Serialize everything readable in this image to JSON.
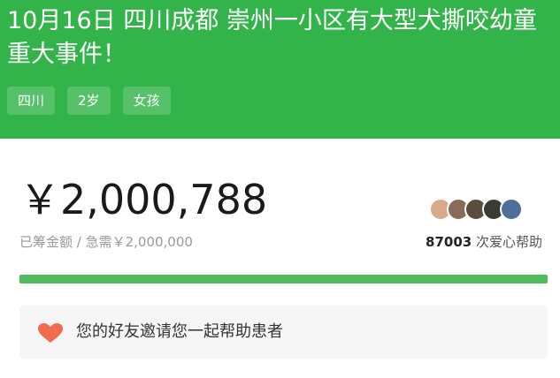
{
  "header": {
    "title": "10月16日 四川成都 崇州一小区有大型犬撕咬幼童重大事件！",
    "tags": [
      "四川",
      "2岁",
      "女孩"
    ],
    "bg_color": "#33b44a"
  },
  "funding": {
    "amount": "￥2,000,788",
    "raised_label": "已筹金额 / 急需￥2,000,000",
    "help_count": "87003",
    "help_suffix": " 次爱心帮助",
    "progress": 1.0,
    "progress_color": "#4fbb5d"
  },
  "avatars": [
    {
      "icon": "avatar-1",
      "color": "#d9a98c"
    },
    {
      "icon": "avatar-2",
      "color": "#8a6b5a"
    },
    {
      "icon": "avatar-3",
      "color": "#5a4d3e"
    },
    {
      "icon": "avatar-4",
      "color": "#3b3b35"
    },
    {
      "icon": "avatar-5",
      "color": "#4f6f9a"
    }
  ],
  "invite": {
    "text": "您的好友邀请您一起帮助患者",
    "icon": "heart-icon",
    "icon_color": "#f36b4d"
  }
}
